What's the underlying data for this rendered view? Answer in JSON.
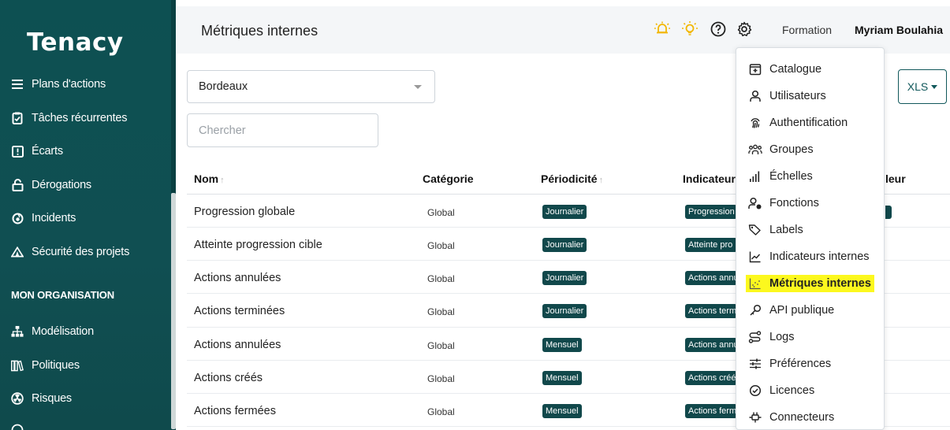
{
  "sidebar": {
    "logo": "Tenacy",
    "items": [
      {
        "label": "Plans d'actions",
        "icon": "list-icon"
      },
      {
        "label": "Tâches récurrentes",
        "icon": "clipboard-check-icon"
      },
      {
        "label": "Écarts",
        "icon": "alert-square-icon"
      },
      {
        "label": "Dérogations",
        "icon": "lock-open-icon"
      },
      {
        "label": "Incidents",
        "icon": "fire-icon"
      },
      {
        "label": "Sécurité des projets",
        "icon": "tent-icon"
      }
    ],
    "section_title": "MON ORGANISATION",
    "org_items": [
      {
        "label": "Modélisation",
        "icon": "hierarchy-icon"
      },
      {
        "label": "Politiques",
        "icon": "books-icon"
      },
      {
        "label": "Risques",
        "icon": "radiation-icon"
      }
    ]
  },
  "header": {
    "title": "Métriques internes",
    "org_label": "Formation",
    "user_name": "Myriam Boulahia",
    "icon_color": "#f2b705"
  },
  "filters": {
    "site_select": "Bordeaux",
    "search_placeholder": "Chercher",
    "export_label": "XLS"
  },
  "table": {
    "columns": [
      "Nom",
      "Catégorie",
      "Périodicité",
      "Indicateur",
      "leur"
    ],
    "rows": [
      {
        "name": "Progression globale",
        "category": "Global",
        "period": "Journalier",
        "indicator": "Progression"
      },
      {
        "name": "Atteinte progression cible",
        "category": "Global",
        "period": "Journalier",
        "indicator": "Atteinte pro"
      },
      {
        "name": "Actions annulées",
        "category": "Global",
        "period": "Journalier",
        "indicator": "Actions annu"
      },
      {
        "name": "Actions terminées",
        "category": "Global",
        "period": "Journalier",
        "indicator": "Actions term"
      },
      {
        "name": "Actions annulées",
        "category": "Global",
        "period": "Mensuel",
        "indicator": "Actions annu"
      },
      {
        "name": "Actions créés",
        "category": "Global",
        "period": "Mensuel",
        "indicator": "Actions créé"
      },
      {
        "name": "Actions fermées",
        "category": "Global",
        "period": "Mensuel",
        "indicator": "Actions ferm"
      }
    ]
  },
  "settings_menu": {
    "items": [
      {
        "label": "Catalogue",
        "icon": "catalog-icon"
      },
      {
        "label": "Utilisateurs",
        "icon": "user-icon"
      },
      {
        "label": "Authentification",
        "icon": "fingerprint-icon"
      },
      {
        "label": "Groupes",
        "icon": "group-icon"
      },
      {
        "label": "Échelles",
        "icon": "scale-bars-icon"
      },
      {
        "label": "Fonctions",
        "icon": "user-gear-icon"
      },
      {
        "label": "Labels",
        "icon": "tag-icon"
      },
      {
        "label": "Indicateurs internes",
        "icon": "chart-line-icon"
      },
      {
        "label": "Métriques internes",
        "icon": "chart-dots-icon",
        "active": true
      },
      {
        "label": "API publique",
        "icon": "key-icon"
      },
      {
        "label": "Logs",
        "icon": "route-icon"
      },
      {
        "label": "Préférences",
        "icon": "sliders-icon"
      },
      {
        "label": "Licences",
        "icon": "badge-check-icon"
      },
      {
        "label": "Connecteurs",
        "icon": "plug-icon"
      }
    ],
    "highlight_color": "#fcf81e"
  },
  "theme": {
    "sidebar_color": "#0d5052",
    "badge_color": "#11484b"
  }
}
